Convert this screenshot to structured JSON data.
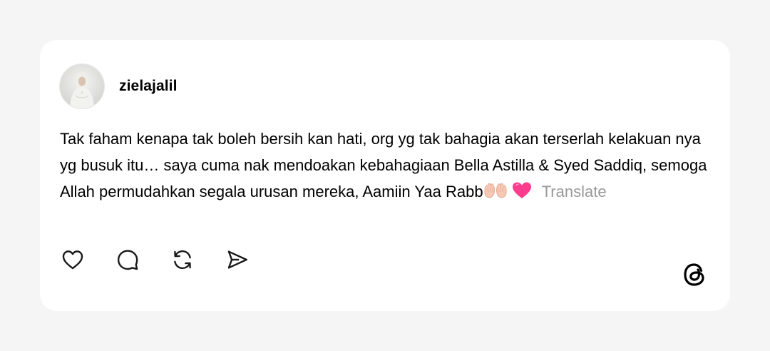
{
  "post": {
    "username": "zielajalil",
    "text": "Tak faham kenapa tak boleh bersih kan hati, org yg tak bahagia akan terserlah kelakuan nya yg busuk itu… saya cuma nak mendoakan kebahagiaan Bella Astilla & Syed Saddiq, semoga Allah permudahkan segala urusan mereka, Aamiin Yaa Rabb",
    "emojis": [
      "raising-hands",
      "pink-heart"
    ],
    "translate_label": "Translate"
  },
  "actions": [
    "heart-icon",
    "comment-icon",
    "repost-icon",
    "share-icon"
  ],
  "brand_logo": "threads-logo-icon",
  "colors": {
    "background": "#f5f5f5",
    "card": "#ffffff",
    "text": "#000000",
    "translate": "#999999",
    "heart": "#ff3b8d"
  }
}
